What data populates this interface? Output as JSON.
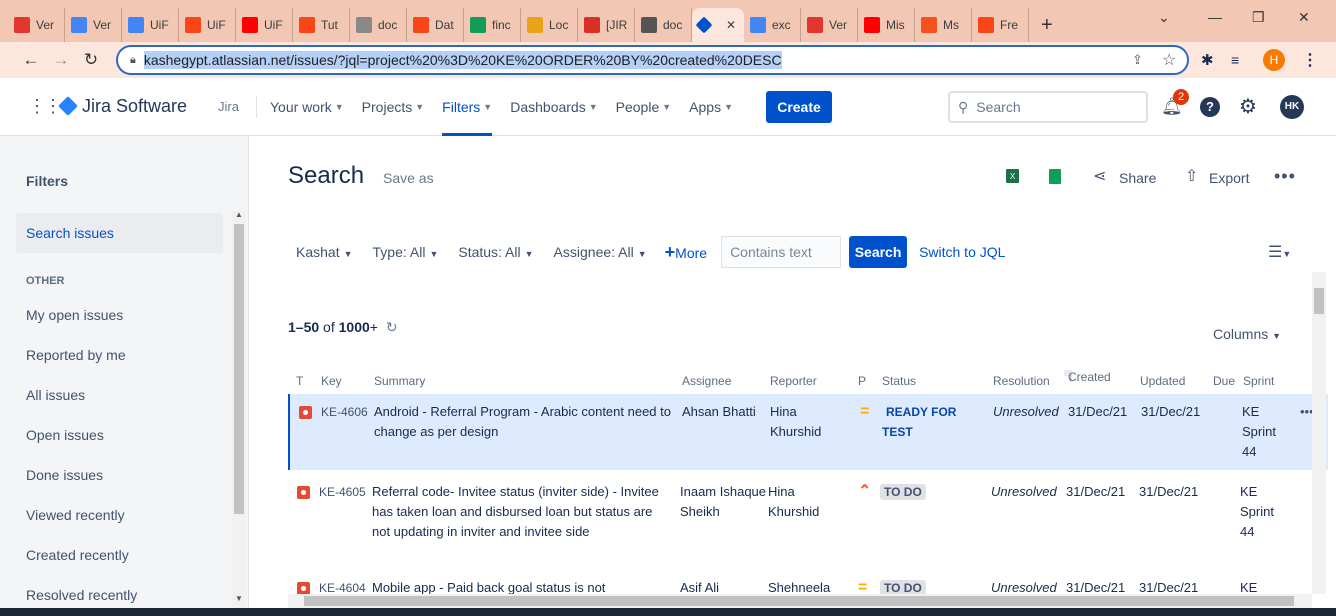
{
  "browser": {
    "tabs": [
      {
        "label": "Ver",
        "icon": "jira-logo-icon",
        "color": "#e2372f"
      },
      {
        "label": "Ver",
        "icon": "docs-icon",
        "color": "#4285f4"
      },
      {
        "label": "UiF",
        "icon": "docs-icon",
        "color": "#4285f4"
      },
      {
        "label": "UiF",
        "icon": "uipath-icon",
        "color": "#fa4616"
      },
      {
        "label": "UiF",
        "icon": "youtube-icon",
        "color": "#ff0000"
      },
      {
        "label": "Tut",
        "icon": "uipath-icon",
        "color": "#fa4616"
      },
      {
        "label": "doc",
        "icon": "globe-icon",
        "color": "#888888"
      },
      {
        "label": "Dat",
        "icon": "uipath-icon",
        "color": "#fa4616"
      },
      {
        "label": "finc",
        "icon": "drive-icon",
        "color": "#0f9d58"
      },
      {
        "label": "Loc",
        "icon": "sheet-icon",
        "color": "#e8a317"
      },
      {
        "label": "[JIR",
        "icon": "gmail-icon",
        "color": "#d93025"
      },
      {
        "label": "doc",
        "icon": "tab-icon",
        "color": "#555555"
      },
      {
        "label": "",
        "icon": "jira-diamond-icon",
        "color": "#0052cc"
      },
      {
        "label": "exc",
        "icon": "google-icon",
        "color": "#4285f4"
      },
      {
        "label": "Ver",
        "icon": "jira-logo-icon",
        "color": "#e2372f"
      },
      {
        "label": "Mis",
        "icon": "youtube-icon",
        "color": "#ff0000"
      },
      {
        "label": "Ms",
        "icon": "f-icon",
        "color": "#f4511e"
      },
      {
        "label": "Fre",
        "icon": "uipath-icon",
        "color": "#fa4616"
      }
    ],
    "url": "kashegypt.atlassian.net/issues/?jql=project%20%3D%20KE%20ORDER%20BY%20created%20DESC",
    "profile_initial": "H"
  },
  "jira": {
    "brand": "Jira Software",
    "product_link": "Jira",
    "nav": [
      "Your work",
      "Projects",
      "Filters",
      "Dashboards",
      "People",
      "Apps"
    ],
    "create": "Create",
    "search_placeholder": "Search",
    "notif_count": "2",
    "avatar": "HK"
  },
  "sidebar": {
    "title": "Filters",
    "search_issues": "Search issues",
    "other_heading": "OTHER",
    "items": [
      "My open issues",
      "Reported by me",
      "All issues",
      "Open issues",
      "Done issues",
      "Viewed recently",
      "Created recently",
      "Resolved recently"
    ]
  },
  "main": {
    "title": "Search",
    "save_as": "Save as",
    "share": "Share",
    "export": "Export",
    "filters": {
      "project": "Kashat",
      "type": "Type: All",
      "status": "Status: All",
      "assignee": "Assignee: All",
      "more": "More",
      "contains_placeholder": "Contains text",
      "search_btn": "Search",
      "switch_jql": "Switch to JQL"
    },
    "count_range": "1–50",
    "count_of": " of ",
    "count_total": "1000",
    "count_plus": "+",
    "columns_btn": "Columns",
    "headers": {
      "t": "T",
      "key": "Key",
      "summary": "Summary",
      "assignee": "Assignee",
      "reporter": "Reporter",
      "p": "P",
      "status": "Status",
      "resolution": "Resolution",
      "created": "Created",
      "updated": "Updated",
      "due": "Due",
      "sprint": "Sprint"
    },
    "rows": [
      {
        "key": "KE-4606",
        "summary": "Android - Referral Program - Arabic content need to change as per design",
        "assignee": "Ahsan Bhatti",
        "reporter": "Hina Khurshid",
        "priority": "medium",
        "status": "READY FOR TEST",
        "resolution": "Unresolved",
        "created": "31/Dec/21",
        "updated": "31/Dec/21",
        "sprint": "KE Sprint 44"
      },
      {
        "key": "KE-4605",
        "summary": "Referral code- Invitee status (inviter side) - Invitee has taken loan and disbursed loan but status are not updating in inviter and invitee side",
        "assignee": "Inaam Ishaque Sheikh",
        "reporter": "Hina Khurshid",
        "priority": "high",
        "status": "TO DO",
        "resolution": "Unresolved",
        "created": "31/Dec/21",
        "updated": "31/Dec/21",
        "sprint": "KE Sprint 44"
      },
      {
        "key": "KE-4604",
        "summary": "Mobile app - Paid back goal status is not",
        "assignee": "Asif Ali",
        "reporter": "Shehneela",
        "priority": "medium",
        "status": "TO DO",
        "resolution": "Unresolved",
        "created": "31/Dec/21",
        "updated": "31/Dec/21",
        "sprint": "KE"
      }
    ]
  }
}
